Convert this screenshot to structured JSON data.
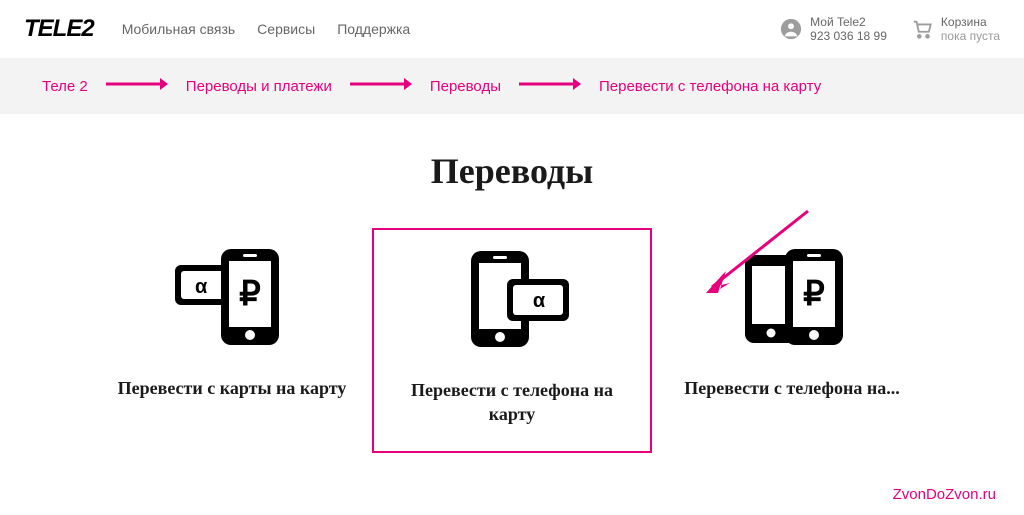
{
  "header": {
    "logo": "TELE2",
    "nav": [
      "Мобильная связь",
      "Сервисы",
      "Поддержка"
    ],
    "account": {
      "title": "Мой Tele2",
      "phone": "923 036 18 99"
    },
    "cart": {
      "title": "Корзина",
      "status": "пока пуста"
    }
  },
  "breadcrumb": {
    "items": [
      "Теле 2",
      "Переводы и платежи",
      "Переводы",
      "Перевести с телефона на карту"
    ]
  },
  "page_title": "Переводы",
  "cards": [
    {
      "label": "Перевести с карты на карту"
    },
    {
      "label": "Перевести с телефона на карту"
    },
    {
      "label": "Перевести с телефона на..."
    }
  ],
  "footer_mark": "ZvonDoZvon.ru",
  "colors": {
    "accent": "#e6007e"
  }
}
